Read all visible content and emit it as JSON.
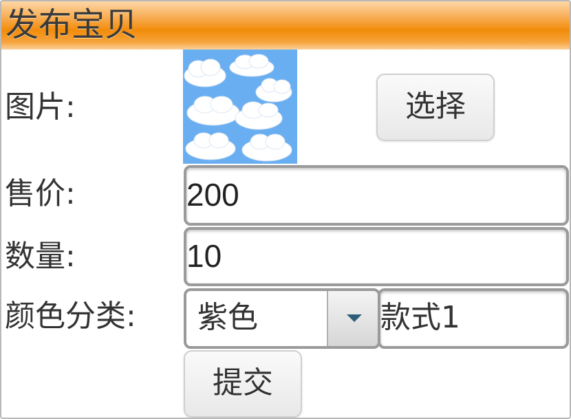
{
  "header": {
    "title": "发布宝贝"
  },
  "form": {
    "image_label": "图片:",
    "price_label": "售价:",
    "quantity_label": "数量:",
    "color_label": "颜色分类:",
    "price_value": "200",
    "quantity_value": "10",
    "color_selected": "紫色",
    "style_value": "款式1",
    "select_button": "选择",
    "submit_button": "提交"
  },
  "colors": {
    "header_orange": "#f28c0a",
    "thumb_sky": "#6aaef2",
    "arrow": "#2f5f78"
  },
  "icons": {
    "thumbnail": "cloud-image",
    "dropdown": "chevron-down-icon"
  }
}
